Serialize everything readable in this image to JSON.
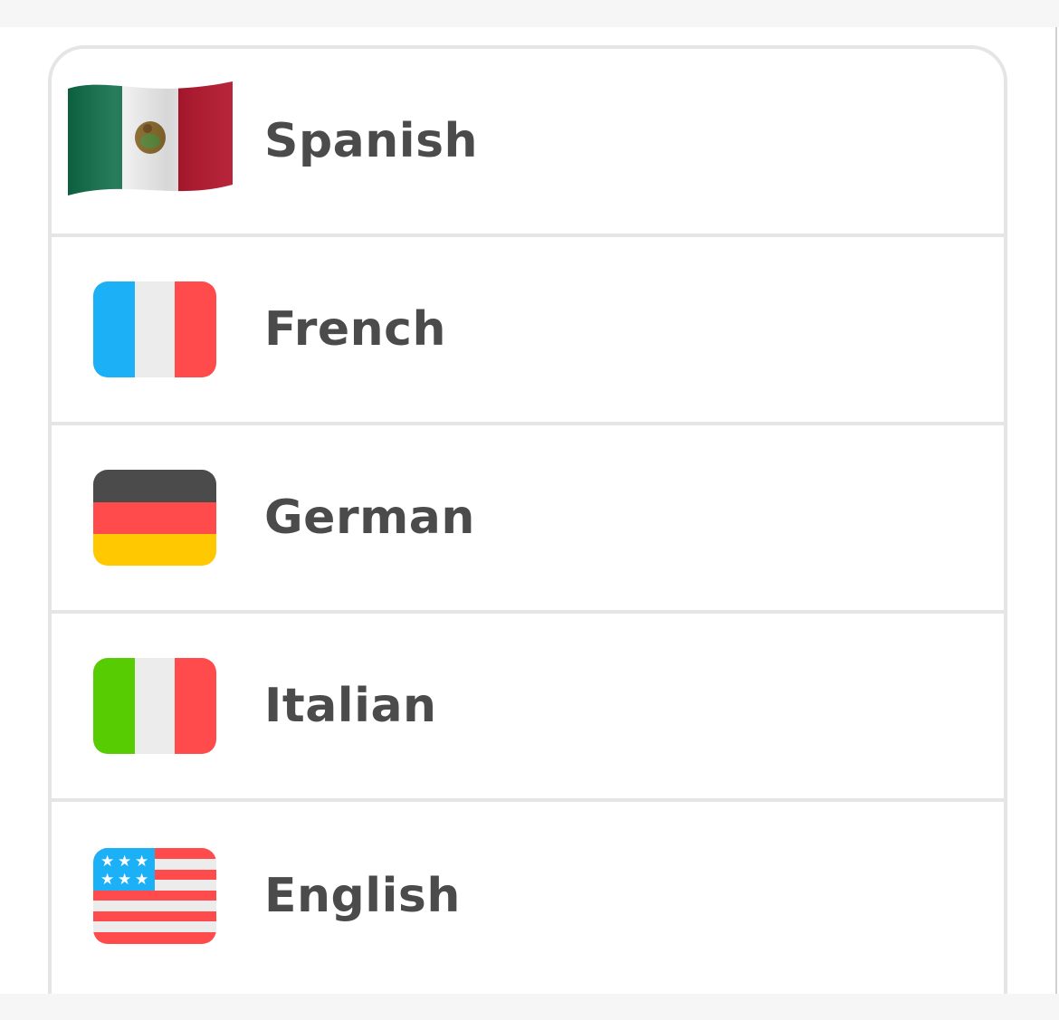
{
  "languages": [
    {
      "label": "Spanish",
      "flag": "mexico-flag-icon"
    },
    {
      "label": "French",
      "flag": "france-flag-icon"
    },
    {
      "label": "German",
      "flag": "germany-flag-icon"
    },
    {
      "label": "Italian",
      "flag": "italy-flag-icon"
    },
    {
      "label": "English",
      "flag": "usa-flag-icon"
    }
  ],
  "colors": {
    "text": "#4b4b4b",
    "border": "#e5e5e5",
    "france_blue": "#1cb0f6",
    "flag_red": "#ff4b4b",
    "flag_white": "#ececec",
    "germany_black": "#4b4b4b",
    "germany_gold": "#ffc800",
    "italy_green": "#58cc02",
    "mexico_green": "#0a6b46",
    "mexico_red": "#b2132a"
  }
}
